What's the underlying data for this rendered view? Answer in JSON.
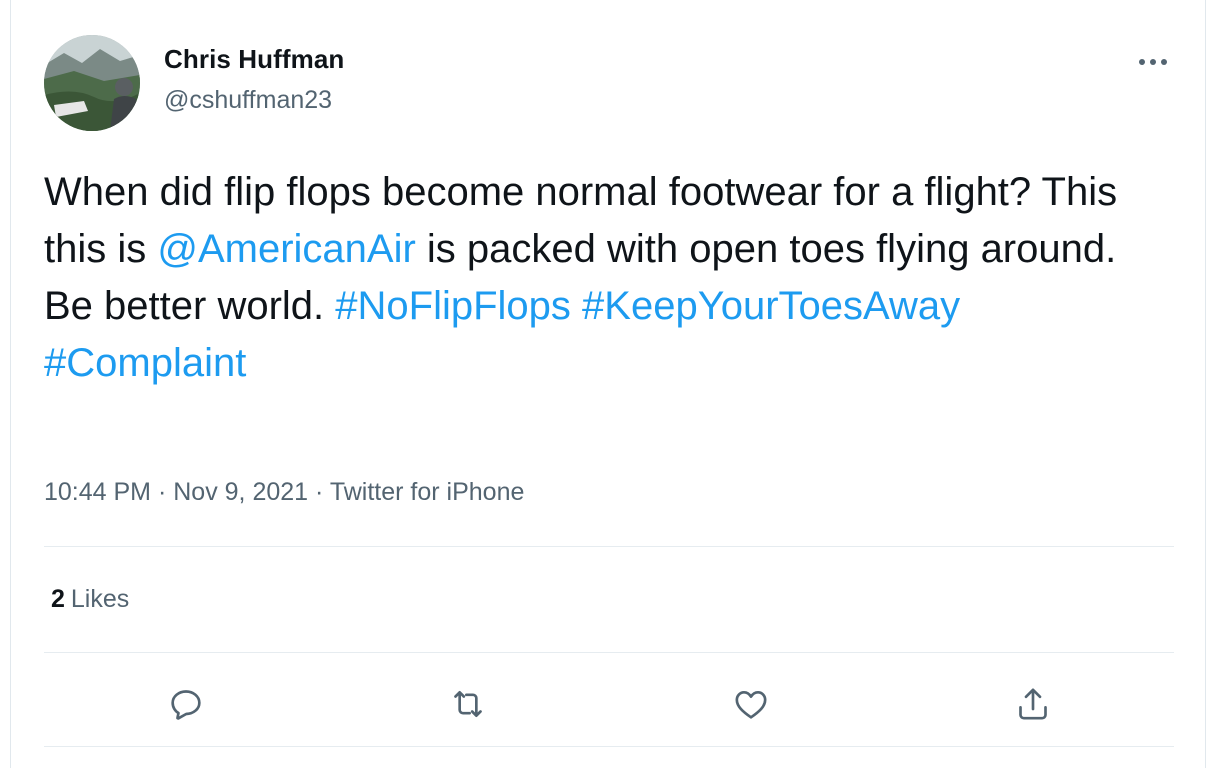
{
  "author": {
    "display_name": "Chris Huffman",
    "handle": "@cshuffman23"
  },
  "tweet": {
    "text_segments": [
      {
        "type": "text",
        "value": "When did flip flops become normal footwear for a flight? This this is "
      },
      {
        "type": "mention",
        "value": "@AmericanAir"
      },
      {
        "type": "text",
        "value": " is packed with open toes flying around. Be better world. "
      },
      {
        "type": "hashtag",
        "value": "#NoFlipFlops"
      },
      {
        "type": "text",
        "value": " "
      },
      {
        "type": "hashtag",
        "value": "#KeepYourToesAway"
      },
      {
        "type": "break"
      },
      {
        "type": "hashtag",
        "value": "#Complaint"
      }
    ],
    "time": "10:44 PM",
    "date": "Nov 9, 2021",
    "separator": "·",
    "source": "Twitter for iPhone"
  },
  "stats": {
    "likes_count": "2",
    "likes_label": "Likes"
  },
  "icons": {
    "more": "more-horizontal-icon",
    "reply": "reply-icon",
    "retweet": "retweet-icon",
    "like": "heart-icon",
    "share": "share-icon"
  },
  "colors": {
    "link": "#1d9bf0",
    "text": "#0f1419",
    "secondary": "#536471",
    "divider": "#e6ecf0"
  }
}
